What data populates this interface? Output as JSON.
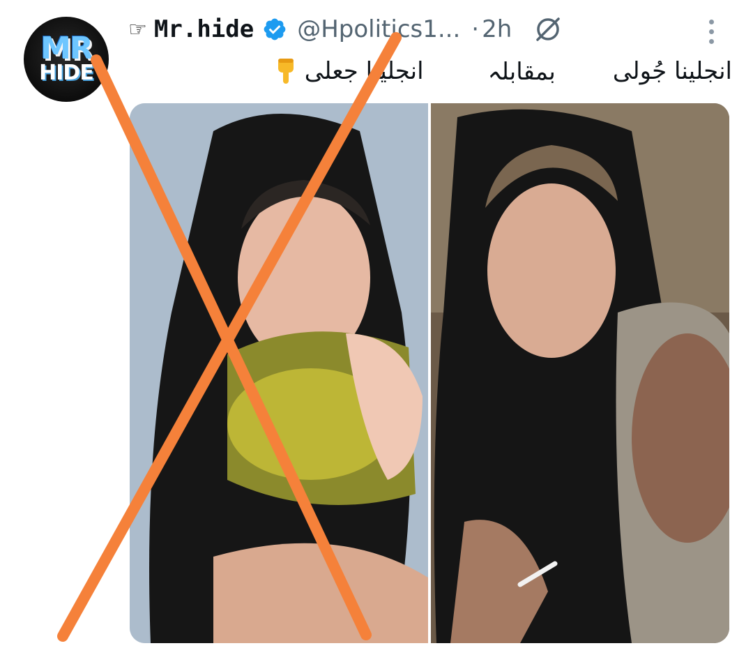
{
  "tweet": {
    "avatar": {
      "line1": "MR",
      "line2": "HIDE",
      "icon": "avatar-logo"
    },
    "pointer_glyph": "☞",
    "display_name": "Mr.hide",
    "verified_icon": "verified-badge-icon",
    "handle": "@Hpolitics1...",
    "separator": "·",
    "timestamp": "2h",
    "grok_icon": "grok-icon",
    "more_icon": "more-vertical-icon",
    "text": {
      "part1": "انجلینا جُولی",
      "part2": "بمقابلہ",
      "part3": "انجلینا جعلی",
      "emoji": "pointing-down-emoji"
    },
    "media": {
      "left_image": "photo-woman-black-scarf-hugging-elderly-woman",
      "right_image": "photo-woman-black-scarf-with-elderly-woman",
      "overlay": "orange-x-cross"
    }
  },
  "colors": {
    "name": "#0f1419",
    "muted": "#536471",
    "verified": "#1d9bf0",
    "cross": "#f5813a",
    "avatar_accent": "#6ec6ff"
  }
}
